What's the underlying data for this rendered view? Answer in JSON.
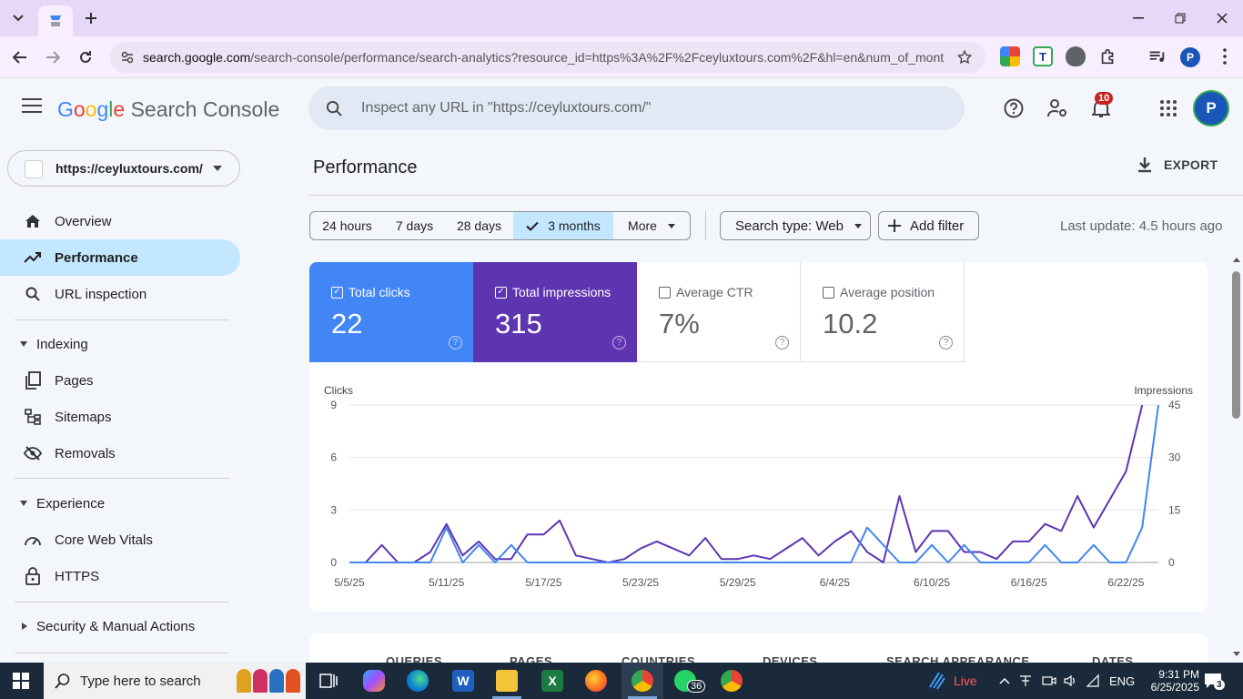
{
  "browser": {
    "url_host": "search.google.com",
    "url_rest": "/search-console/performance/search-analytics?resource_id=https%3A%2F%2Fceyluxtours.com%2F&hl=en&num_of_mont..."
  },
  "header": {
    "logo_google": "Google",
    "logo_product": "Search Console",
    "inspect_placeholder": "Inspect any URL in \"https://ceyluxtours.com/\"",
    "notifications_count": "10",
    "avatar_letter": "P"
  },
  "sidebar": {
    "property": "https://ceyluxtours.com/",
    "items": [
      {
        "label": "Overview"
      },
      {
        "label": "Performance"
      },
      {
        "label": "URL inspection"
      },
      {
        "label": "Indexing"
      },
      {
        "label": "Pages"
      },
      {
        "label": "Sitemaps"
      },
      {
        "label": "Removals"
      },
      {
        "label": "Experience"
      },
      {
        "label": "Core Web Vitals"
      },
      {
        "label": "HTTPS"
      },
      {
        "label": "Security & Manual Actions"
      }
    ]
  },
  "main": {
    "title": "Performance",
    "export_label": "EXPORT",
    "ranges": [
      "24 hours",
      "7 days",
      "28 days",
      "3 months",
      "More"
    ],
    "selected_range": "3 months",
    "search_type": "Search type: Web",
    "add_filter": "Add filter",
    "last_update": "Last update: 4.5 hours ago",
    "metrics": [
      {
        "label": "Total clicks",
        "value": "22",
        "checked": true
      },
      {
        "label": "Total impressions",
        "value": "315",
        "checked": true
      },
      {
        "label": "Average CTR",
        "value": "7%",
        "checked": false
      },
      {
        "label": "Average position",
        "value": "10.2",
        "checked": false
      }
    ],
    "bottom_tabs": [
      "QUERIES",
      "PAGES",
      "COUNTRIES",
      "DEVICES",
      "SEARCH APPEARANCE",
      "DATES"
    ]
  },
  "chart_data": {
    "type": "line",
    "ylabel_left": "Clicks",
    "ylabel_right": "Impressions",
    "ylim_left": [
      0,
      9
    ],
    "ylim_right": [
      0,
      45
    ],
    "yticks_left": [
      "0",
      "3",
      "6",
      "9"
    ],
    "yticks_right": [
      "0",
      "15",
      "30",
      "45"
    ],
    "x_tick_labels": [
      "5/5/25",
      "5/11/25",
      "5/17/25",
      "5/23/25",
      "5/29/25",
      "6/4/25",
      "6/10/25",
      "6/16/25",
      "6/22/25"
    ],
    "x_start": "5/5/25",
    "series": [
      {
        "name": "Clicks",
        "axis": "left",
        "color": "#4285f4",
        "values": [
          0,
          0,
          0,
          0,
          0,
          0,
          2,
          0,
          1,
          0,
          1,
          0,
          0,
          0,
          0,
          0,
          0,
          0,
          0,
          0,
          0,
          0,
          0,
          0,
          0,
          0,
          0,
          0,
          0,
          0,
          0,
          0,
          2,
          1,
          0,
          0,
          1,
          0,
          1,
          0,
          0,
          0,
          0,
          1,
          0,
          0,
          1,
          0,
          0,
          2,
          9
        ]
      },
      {
        "name": "Impressions",
        "axis": "right",
        "color": "#5e35b1",
        "values": [
          0,
          0,
          5,
          0,
          0,
          3,
          11,
          2,
          6,
          1,
          1,
          8,
          8,
          12,
          2,
          1,
          0,
          1,
          4,
          6,
          4,
          2,
          7,
          1,
          1,
          2,
          1,
          4,
          7,
          2,
          6,
          9,
          3,
          0,
          19,
          3,
          9,
          9,
          3,
          3,
          1,
          6,
          6,
          11,
          9,
          19,
          10,
          18,
          26,
          45
        ]
      }
    ]
  },
  "taskbar": {
    "search_label": "Type here to search",
    "live_label": "Live",
    "whatsapp_badge": "36",
    "lang": "ENG",
    "time": "9:31 PM",
    "date": "6/25/2025",
    "notif_count": "3"
  }
}
